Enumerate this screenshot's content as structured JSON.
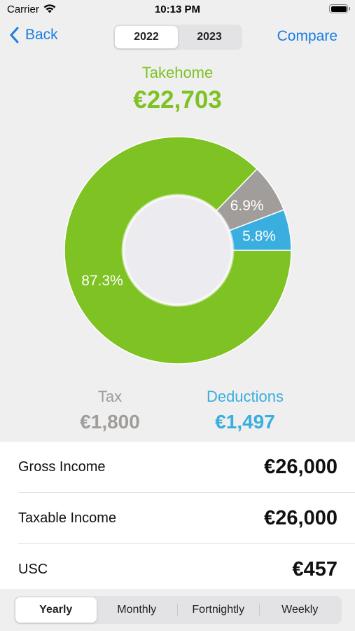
{
  "status_bar": {
    "carrier": "Carrier",
    "time": "10:13 PM"
  },
  "nav": {
    "back_label": "Back",
    "compare_label": "Compare",
    "years": [
      "2022",
      "2023"
    ],
    "selected_year": "2022"
  },
  "takehome": {
    "label": "Takehome",
    "value": "€22,703"
  },
  "chart_data": {
    "type": "pie",
    "donut": true,
    "slices": [
      {
        "name": "Takehome",
        "percent": 87.3,
        "label": "87.3%",
        "color": "#7ec223"
      },
      {
        "name": "Tax",
        "percent": 6.9,
        "label": "6.9%",
        "color": "#a09d9a"
      },
      {
        "name": "Deductions",
        "percent": 5.8,
        "label": "5.8%",
        "color": "#3aaede"
      }
    ]
  },
  "summary": {
    "tax": {
      "label": "Tax",
      "value": "€1,800"
    },
    "deductions": {
      "label": "Deductions",
      "value": "€1,497"
    }
  },
  "rows": [
    {
      "label": "Gross Income",
      "value": "€26,000"
    },
    {
      "label": "Taxable Income",
      "value": "€26,000"
    },
    {
      "label": "USC",
      "value": "€457"
    }
  ],
  "periods": [
    "Yearly",
    "Monthly",
    "Fortnightly",
    "Weekly"
  ],
  "selected_period": "Yearly",
  "colors": {
    "accent": "#1a7de0",
    "takehome": "#7ec223",
    "tax": "#a09d9a",
    "deductions": "#3aaede"
  }
}
